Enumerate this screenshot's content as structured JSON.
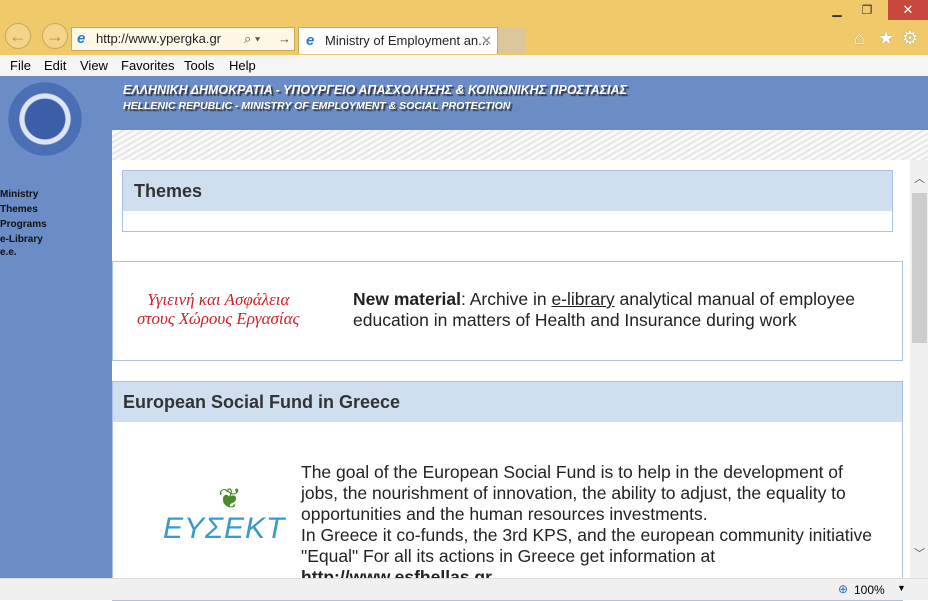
{
  "browser": {
    "url": "http://www.ypergka.gr",
    "tab_title": "Ministry of Employment an...",
    "menu": [
      "File",
      "Edit",
      "View",
      "Favorites",
      "Tools",
      "Help"
    ],
    "zoom": "100%"
  },
  "header": {
    "greek": "ΕΛΛΗΝΙΚΗ ΔΗΜΟΚΡΑΤΙΑ - ΥΠΟΥΡΓΕΙΟ ΑΠΑΣΧΟΛΗΣΗΣ & ΚΟΙΝΩΝΙΚΗΣ ΠΡΟΣΤΑΣΙΑΣ",
    "english": "HELLENIC REPUBLIC - MINISTRY OF EMPLOYMENT & SOCIAL PROTECTION"
  },
  "sidebar": {
    "items": [
      "Ministry",
      "Themes",
      "Programs",
      "e-Library",
      "e.e."
    ]
  },
  "themes": {
    "title": "Themes"
  },
  "news": {
    "logo_line1": "Υγιεινή και Ασφάλεια",
    "logo_line2": "στους Χώρους Εργασίας",
    "bold": "New material",
    "pre": ": Archive in ",
    "link": "e-library",
    "post": " analytical manual of employee education in matters of Health and Insurance during work"
  },
  "esf": {
    "title": "European Social Fund in Greece",
    "logo": "ΕΥΣΕΚΤ",
    "p1": "The goal of the European Social Fund is to help in the development of jobs, the nourishment of innovation, the ability to adjust, the equality to opportunities and the human resources investments.",
    "p2": "In Greece it co-funds, the 3rd KPS, and the european community initiative \"Equal\" For all its actions in Greece get information at",
    "link": "http://www.esfhellas.gr"
  }
}
